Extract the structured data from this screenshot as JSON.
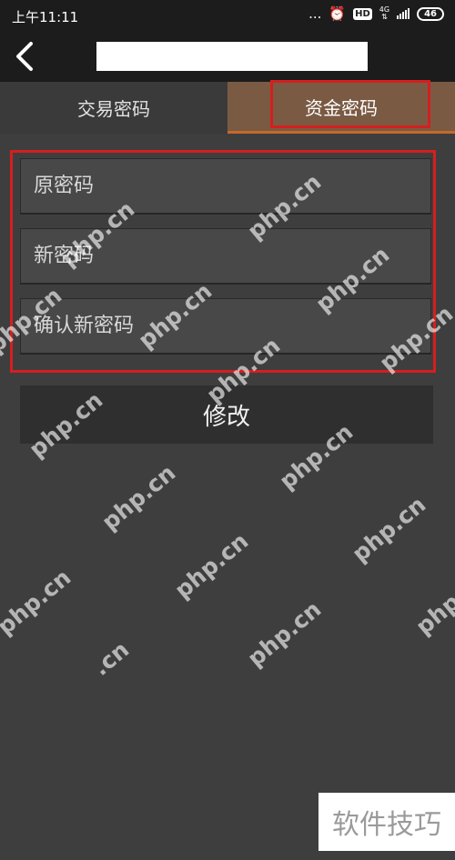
{
  "status_bar": {
    "time": "上午11:11",
    "dots": "...",
    "hd": "HD",
    "network": "4G",
    "battery": "46"
  },
  "header": {
    "title": ""
  },
  "tabs": [
    {
      "label": "交易密码",
      "active": false
    },
    {
      "label": "资金密码",
      "active": true
    }
  ],
  "form": {
    "fields": [
      {
        "placeholder": "原密码",
        "value": ""
      },
      {
        "placeholder": "新密码",
        "value": ""
      },
      {
        "placeholder": "确认新密码",
        "value": ""
      }
    ],
    "submit_label": "修改"
  },
  "watermarks": [
    "php.cn",
    "php.cn",
    "php.cn",
    "php.cn",
    "php.cn",
    "php.cn",
    "php.cn",
    "php.cn",
    "php.cn",
    "php.cn",
    "php.cn",
    "php.cn",
    ".cn"
  ],
  "corner_badge": "软件技巧",
  "colors": {
    "background": "#3e3e3e",
    "header": "#1c1c1c",
    "active_tab": "#7b5a44",
    "highlight": "#d41f1f"
  }
}
